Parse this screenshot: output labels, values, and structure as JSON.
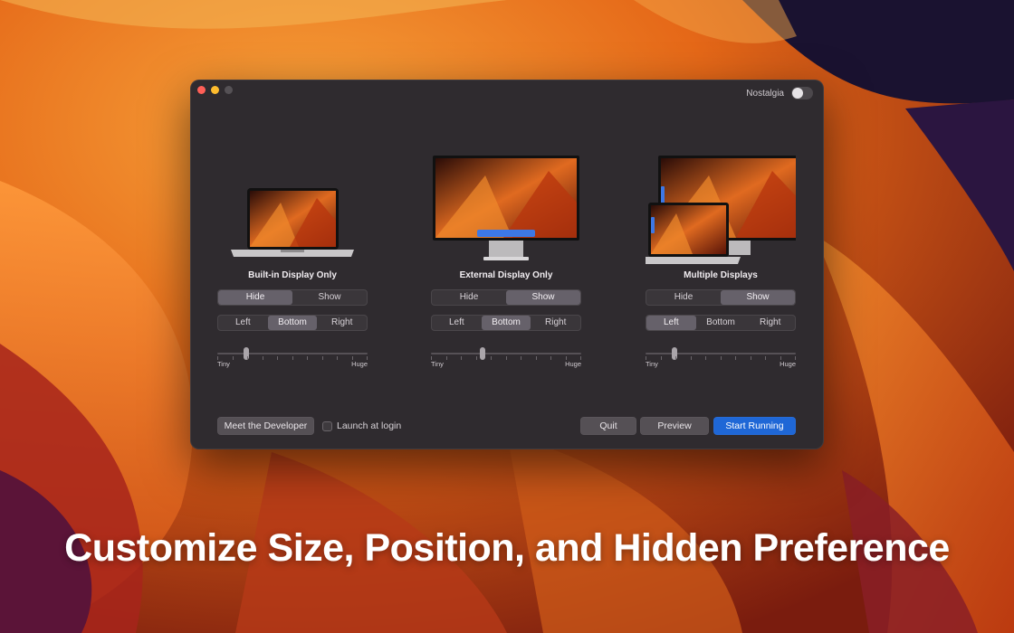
{
  "caption": "Customize Size, Position, and Hidden Preference",
  "window": {
    "nostalgia_label": "Nostalgia",
    "nostalgia_on": false
  },
  "columns": [
    {
      "title": "Built-in Display Only",
      "visibility": [
        "Hide",
        "Show"
      ],
      "visibility_selected": "Hide",
      "position": [
        "Left",
        "Bottom",
        "Right"
      ],
      "position_selected": "Bottom",
      "size_min_label": "Tiny",
      "size_max_label": "Huge",
      "size_value": 0.18
    },
    {
      "title": "External Display Only",
      "visibility": [
        "Hide",
        "Show"
      ],
      "visibility_selected": "Show",
      "position": [
        "Left",
        "Bottom",
        "Right"
      ],
      "position_selected": "Bottom",
      "size_min_label": "Tiny",
      "size_max_label": "Huge",
      "size_value": 0.34
    },
    {
      "title": "Multiple Displays",
      "visibility": [
        "Hide",
        "Show"
      ],
      "visibility_selected": "Show",
      "position": [
        "Left",
        "Bottom",
        "Right"
      ],
      "position_selected": "Left",
      "size_min_label": "Tiny",
      "size_max_label": "Huge",
      "size_value": 0.18
    }
  ],
  "footer": {
    "meet_developer": "Meet the Developer",
    "launch_at_login": "Launch at login",
    "launch_checked": false,
    "quit": "Quit",
    "preview": "Preview",
    "start_running": "Start Running"
  },
  "colors": {
    "accent": "#1f67d6",
    "dock_highlight": "#3d78e6",
    "window_bg": "#2f2b2f"
  }
}
